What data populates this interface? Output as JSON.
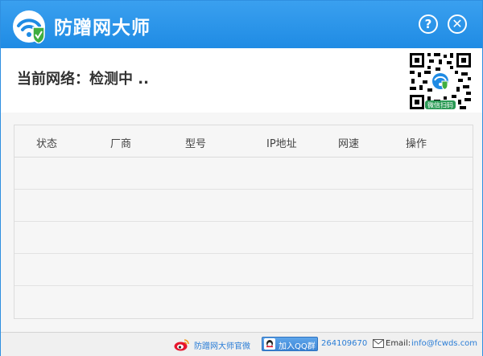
{
  "app": {
    "title": "防蹭网大师",
    "help_glyph": "?",
    "close_glyph": "✕"
  },
  "status": {
    "text": "当前网络：检测中 .."
  },
  "qr": {
    "caption": "微信扫码"
  },
  "table": {
    "columns": [
      "状态",
      "厂商",
      "型号",
      "IP地址",
      "网速",
      "操作"
    ],
    "rows": []
  },
  "footer": {
    "weibo_label": "防蹭网大师官微",
    "qq_group_label": "加入QQ群",
    "qq_group_number": "264109670",
    "email_label": "Email:",
    "email_address": "info@fcwds.com"
  },
  "colors": {
    "titlebar": "#1f8be4",
    "link": "#2a7dd6",
    "accent_green": "#3fae3f"
  },
  "icons": [
    "wifi-shield-logo-icon",
    "help-icon",
    "close-icon",
    "qr-code-icon",
    "weibo-icon",
    "qq-icon",
    "email-icon"
  ]
}
